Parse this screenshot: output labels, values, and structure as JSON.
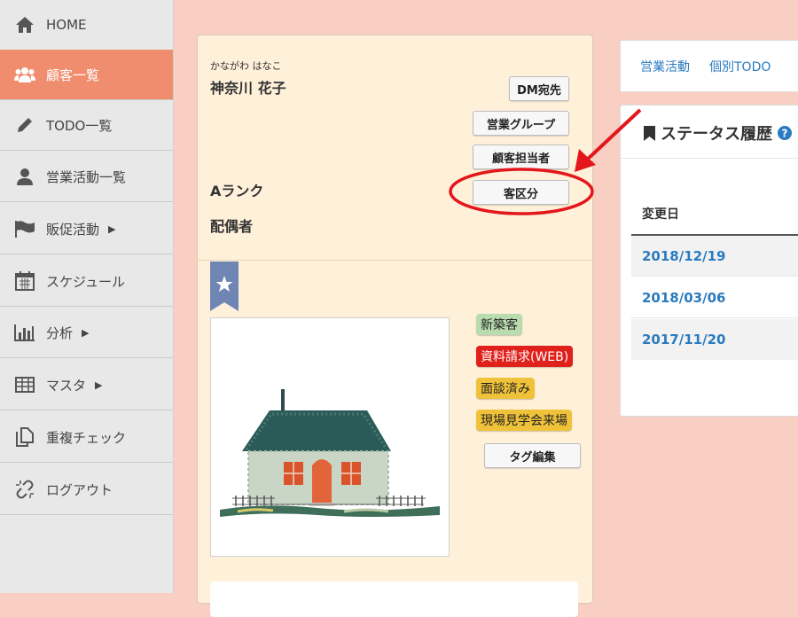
{
  "sidebar": {
    "items": [
      {
        "label": "HOME",
        "icon": "home-icon"
      },
      {
        "label": "顧客一覧",
        "icon": "users-icon"
      },
      {
        "label": "TODO一覧",
        "icon": "pencil-icon"
      },
      {
        "label": "営業活動一覧",
        "icon": "user-icon"
      },
      {
        "label": "販促活動",
        "icon": "flag-icon"
      },
      {
        "label": "スケジュール",
        "icon": "calendar-icon"
      },
      {
        "label": "分析",
        "icon": "bar-chart-icon"
      },
      {
        "label": "マスタ",
        "icon": "table-icon"
      },
      {
        "label": "重複チェック",
        "icon": "copy-icon"
      },
      {
        "label": "ログアウト",
        "icon": "unlink-icon"
      }
    ],
    "active_color": "#f08d6e"
  },
  "customer": {
    "furigana": "かながわ はなこ",
    "name": "神奈川 花子",
    "rank": "Aランク",
    "spouse_label": "配偶者"
  },
  "buttons": {
    "dm": "DM宛先",
    "sales_group": "営業グループ",
    "staff": "顧客担当者",
    "category": "客区分",
    "tag_edit": "タグ編集"
  },
  "tags": [
    {
      "label": "新築客",
      "color": "#b9dcae"
    },
    {
      "label": "資料請求(WEB)",
      "color": "#e0201b"
    },
    {
      "label": "面談済み",
      "color": "#f0c23a"
    },
    {
      "label": "現場見学会来場",
      "color": "#f0c23a"
    }
  ],
  "top_tabs": {
    "sales_activity": "営業活動",
    "todo": "個別TODO"
  },
  "status_history": {
    "title": "ステータス履歴",
    "column": "変更日",
    "dates": [
      "2018/12/19",
      "2018/03/06",
      "2017/11/20"
    ]
  },
  "annotation_color": "#e3171b"
}
